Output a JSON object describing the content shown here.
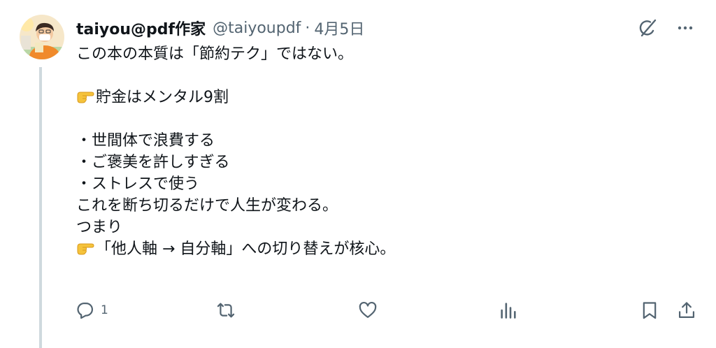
{
  "tweet": {
    "display_name": "taiyou@pdf作家",
    "handle": "@taiyoupdf",
    "separator": "·",
    "date": "4月5日",
    "lines": [
      {
        "text": "この本の本質は「節約テク」ではない。",
        "emoji": ""
      },
      {
        "text": "",
        "emoji": ""
      },
      {
        "text": "貯金はメンタル9割",
        "emoji": "point-right"
      },
      {
        "text": "",
        "emoji": ""
      },
      {
        "text": "・世間体で浪費する",
        "emoji": ""
      },
      {
        "text": "・ご褒美を許しすぎる",
        "emoji": ""
      },
      {
        "text": "・ストレスで使う",
        "emoji": ""
      },
      {
        "text": "これを断ち切るだけで人生が変わる。",
        "emoji": ""
      },
      {
        "text": "つまり",
        "emoji": ""
      },
      {
        "text": "「他人軸 → 自分軸」への切り替えが核心。",
        "emoji": "point-right"
      }
    ],
    "reply_count": "1"
  },
  "icons": {
    "grok": "grok-icon",
    "more": "more-icon",
    "reply": "reply-icon",
    "retweet": "retweet-icon",
    "like": "like-icon",
    "views": "views-icon",
    "bookmark": "bookmark-icon",
    "share": "share-icon",
    "emoji": "point-right-emoji"
  },
  "colors": {
    "text": "#0f1419",
    "secondary": "#536471",
    "thread_line": "#cfd9de",
    "emoji": "#f5c33b"
  }
}
